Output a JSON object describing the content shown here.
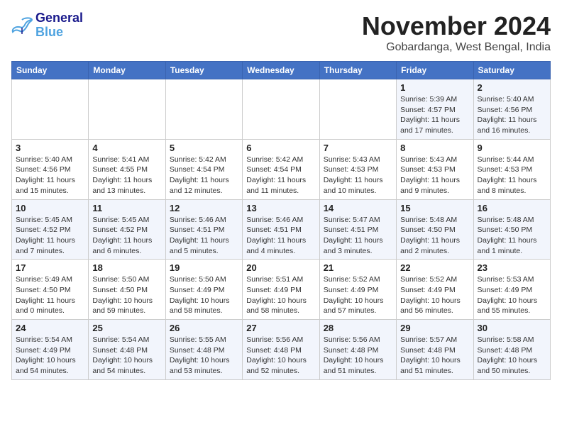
{
  "logo": {
    "line1": "General",
    "line2": "Blue"
  },
  "title": "November 2024",
  "location": "Gobardanga, West Bengal, India",
  "weekdays": [
    "Sunday",
    "Monday",
    "Tuesday",
    "Wednesday",
    "Thursday",
    "Friday",
    "Saturday"
  ],
  "weeks": [
    [
      {
        "day": "",
        "info": ""
      },
      {
        "day": "",
        "info": ""
      },
      {
        "day": "",
        "info": ""
      },
      {
        "day": "",
        "info": ""
      },
      {
        "day": "",
        "info": ""
      },
      {
        "day": "1",
        "info": "Sunrise: 5:39 AM\nSunset: 4:57 PM\nDaylight: 11 hours\nand 17 minutes."
      },
      {
        "day": "2",
        "info": "Sunrise: 5:40 AM\nSunset: 4:56 PM\nDaylight: 11 hours\nand 16 minutes."
      }
    ],
    [
      {
        "day": "3",
        "info": "Sunrise: 5:40 AM\nSunset: 4:56 PM\nDaylight: 11 hours\nand 15 minutes."
      },
      {
        "day": "4",
        "info": "Sunrise: 5:41 AM\nSunset: 4:55 PM\nDaylight: 11 hours\nand 13 minutes."
      },
      {
        "day": "5",
        "info": "Sunrise: 5:42 AM\nSunset: 4:54 PM\nDaylight: 11 hours\nand 12 minutes."
      },
      {
        "day": "6",
        "info": "Sunrise: 5:42 AM\nSunset: 4:54 PM\nDaylight: 11 hours\nand 11 minutes."
      },
      {
        "day": "7",
        "info": "Sunrise: 5:43 AM\nSunset: 4:53 PM\nDaylight: 11 hours\nand 10 minutes."
      },
      {
        "day": "8",
        "info": "Sunrise: 5:43 AM\nSunset: 4:53 PM\nDaylight: 11 hours\nand 9 minutes."
      },
      {
        "day": "9",
        "info": "Sunrise: 5:44 AM\nSunset: 4:53 PM\nDaylight: 11 hours\nand 8 minutes."
      }
    ],
    [
      {
        "day": "10",
        "info": "Sunrise: 5:45 AM\nSunset: 4:52 PM\nDaylight: 11 hours\nand 7 minutes."
      },
      {
        "day": "11",
        "info": "Sunrise: 5:45 AM\nSunset: 4:52 PM\nDaylight: 11 hours\nand 6 minutes."
      },
      {
        "day": "12",
        "info": "Sunrise: 5:46 AM\nSunset: 4:51 PM\nDaylight: 11 hours\nand 5 minutes."
      },
      {
        "day": "13",
        "info": "Sunrise: 5:46 AM\nSunset: 4:51 PM\nDaylight: 11 hours\nand 4 minutes."
      },
      {
        "day": "14",
        "info": "Sunrise: 5:47 AM\nSunset: 4:51 PM\nDaylight: 11 hours\nand 3 minutes."
      },
      {
        "day": "15",
        "info": "Sunrise: 5:48 AM\nSunset: 4:50 PM\nDaylight: 11 hours\nand 2 minutes."
      },
      {
        "day": "16",
        "info": "Sunrise: 5:48 AM\nSunset: 4:50 PM\nDaylight: 11 hours\nand 1 minute."
      }
    ],
    [
      {
        "day": "17",
        "info": "Sunrise: 5:49 AM\nSunset: 4:50 PM\nDaylight: 11 hours\nand 0 minutes."
      },
      {
        "day": "18",
        "info": "Sunrise: 5:50 AM\nSunset: 4:50 PM\nDaylight: 10 hours\nand 59 minutes."
      },
      {
        "day": "19",
        "info": "Sunrise: 5:50 AM\nSunset: 4:49 PM\nDaylight: 10 hours\nand 58 minutes."
      },
      {
        "day": "20",
        "info": "Sunrise: 5:51 AM\nSunset: 4:49 PM\nDaylight: 10 hours\nand 58 minutes."
      },
      {
        "day": "21",
        "info": "Sunrise: 5:52 AM\nSunset: 4:49 PM\nDaylight: 10 hours\nand 57 minutes."
      },
      {
        "day": "22",
        "info": "Sunrise: 5:52 AM\nSunset: 4:49 PM\nDaylight: 10 hours\nand 56 minutes."
      },
      {
        "day": "23",
        "info": "Sunrise: 5:53 AM\nSunset: 4:49 PM\nDaylight: 10 hours\nand 55 minutes."
      }
    ],
    [
      {
        "day": "24",
        "info": "Sunrise: 5:54 AM\nSunset: 4:49 PM\nDaylight: 10 hours\nand 54 minutes."
      },
      {
        "day": "25",
        "info": "Sunrise: 5:54 AM\nSunset: 4:48 PM\nDaylight: 10 hours\nand 54 minutes."
      },
      {
        "day": "26",
        "info": "Sunrise: 5:55 AM\nSunset: 4:48 PM\nDaylight: 10 hours\nand 53 minutes."
      },
      {
        "day": "27",
        "info": "Sunrise: 5:56 AM\nSunset: 4:48 PM\nDaylight: 10 hours\nand 52 minutes."
      },
      {
        "day": "28",
        "info": "Sunrise: 5:56 AM\nSunset: 4:48 PM\nDaylight: 10 hours\nand 51 minutes."
      },
      {
        "day": "29",
        "info": "Sunrise: 5:57 AM\nSunset: 4:48 PM\nDaylight: 10 hours\nand 51 minutes."
      },
      {
        "day": "30",
        "info": "Sunrise: 5:58 AM\nSunset: 4:48 PM\nDaylight: 10 hours\nand 50 minutes."
      }
    ]
  ]
}
